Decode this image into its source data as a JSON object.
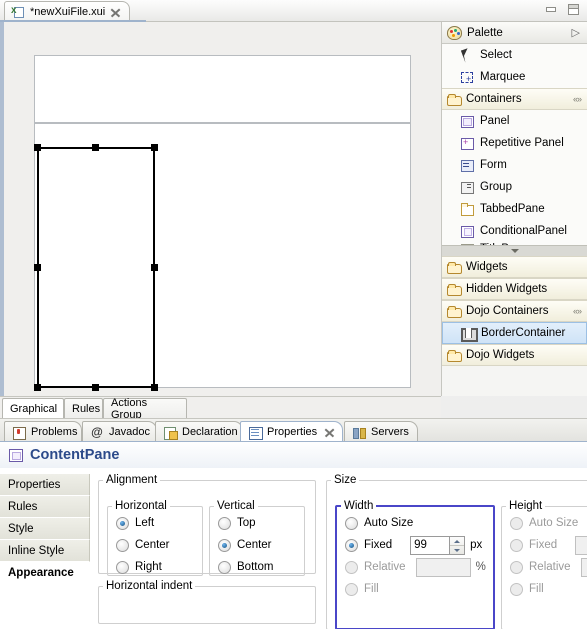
{
  "window": {
    "minimize_label": "Minimize",
    "maximize_label": "Maximize"
  },
  "editor": {
    "tab_title": "*newXuiFile.xui",
    "tab_icon": "xui-file-icon",
    "close_icon": "close-icon",
    "view_tabs": [
      {
        "label": "Graphical",
        "active": true
      },
      {
        "label": "Rules",
        "active": false
      },
      {
        "label": "Actions Group",
        "active": false
      }
    ]
  },
  "palette": {
    "header": {
      "title": "Palette",
      "icon": "palette-icon",
      "expand_icon": "triangle-right-icon"
    },
    "tools": [
      {
        "label": "Select",
        "icon": "cursor-arrow-icon"
      },
      {
        "label": "Marquee",
        "icon": "marquee-select-icon"
      }
    ],
    "sections": [
      {
        "title": "Containers",
        "icon": "open-folder-icon",
        "collapse_icon": "collapse-chevrons-icon",
        "expanded": true,
        "items": [
          {
            "label": "Panel",
            "icon": "panel-icon",
            "selected": false
          },
          {
            "label": "Repetitive Panel",
            "icon": "repetitive-panel-icon",
            "selected": false
          },
          {
            "label": "Form",
            "icon": "form-icon",
            "selected": false
          },
          {
            "label": "Group",
            "icon": "group-icon",
            "selected": false
          },
          {
            "label": "TabbedPane",
            "icon": "tabbed-pane-icon",
            "selected": false
          },
          {
            "label": "ConditionalPanel",
            "icon": "conditional-panel-icon",
            "selected": false
          },
          {
            "label": "TitlePane",
            "icon": "title-pane-icon",
            "selected": false
          }
        ]
      },
      {
        "title": "Widgets",
        "icon": "open-folder-icon",
        "expanded": false,
        "items": []
      },
      {
        "title": "Hidden Widgets",
        "icon": "open-folder-icon",
        "expanded": false,
        "items": []
      },
      {
        "title": "Dojo Containers",
        "icon": "open-folder-icon",
        "collapse_icon": "collapse-chevrons-icon",
        "expanded": true,
        "items": [
          {
            "label": "BorderContainer",
            "icon": "border-container-icon",
            "selected": true
          }
        ]
      },
      {
        "title": "Dojo Widgets",
        "icon": "open-folder-icon",
        "expanded": false,
        "items": []
      }
    ]
  },
  "bottom_view": {
    "tabs": [
      {
        "label": "Problems",
        "icon": "problems-icon",
        "active": false,
        "closable": false
      },
      {
        "label": "Javadoc",
        "icon": "javadoc-icon",
        "active": false,
        "closable": false
      },
      {
        "label": "Declaration",
        "icon": "declaration-icon",
        "active": false,
        "closable": false
      },
      {
        "label": "Properties",
        "icon": "properties-icon",
        "active": true,
        "closable": true
      },
      {
        "label": "Servers",
        "icon": "servers-icon",
        "active": false,
        "closable": false
      }
    ]
  },
  "properties": {
    "title": "ContentPane",
    "title_icon": "content-pane-icon",
    "left_tabs": [
      {
        "label": "Properties",
        "active": false
      },
      {
        "label": "Rules",
        "active": false
      },
      {
        "label": "Style",
        "active": false
      },
      {
        "label": "Inline Style",
        "active": false
      },
      {
        "label": "Appearance",
        "active": true
      }
    ],
    "alignment": {
      "legend": "Alignment",
      "horizontal": {
        "legend": "Horizontal",
        "options": [
          {
            "label": "Left",
            "selected": true,
            "disabled": false
          },
          {
            "label": "Center",
            "selected": false,
            "disabled": false
          },
          {
            "label": "Right",
            "selected": false,
            "disabled": false
          }
        ]
      },
      "vertical": {
        "legend": "Vertical",
        "options": [
          {
            "label": "Top",
            "selected": false,
            "disabled": false
          },
          {
            "label": "Center",
            "selected": true,
            "disabled": false
          },
          {
            "label": "Bottom",
            "selected": false,
            "disabled": false
          }
        ]
      }
    },
    "horizontal_indent": {
      "legend": "Horizontal indent"
    },
    "size": {
      "legend": "Size",
      "highlight_color": "#4a46c8",
      "width": {
        "legend": "Width",
        "highlighted": true,
        "options": [
          {
            "label": "Auto Size",
            "selected": false,
            "disabled": false
          },
          {
            "label": "Fixed",
            "selected": true,
            "disabled": false
          },
          {
            "label": "Relative",
            "selected": false,
            "disabled": true
          },
          {
            "label": "Fill",
            "selected": false,
            "disabled": true
          }
        ],
        "fixed_value": "99",
        "fixed_unit": "px",
        "relative_value": "",
        "relative_unit": "%"
      },
      "height": {
        "legend": "Height",
        "highlighted": false,
        "options": [
          {
            "label": "Auto Size",
            "selected": false,
            "disabled": true
          },
          {
            "label": "Fixed",
            "selected": false,
            "disabled": true
          },
          {
            "label": "Relative",
            "selected": false,
            "disabled": true
          },
          {
            "label": "Fill",
            "selected": false,
            "disabled": true
          }
        ],
        "fixed_value": "",
        "relative_value": ""
      }
    }
  }
}
